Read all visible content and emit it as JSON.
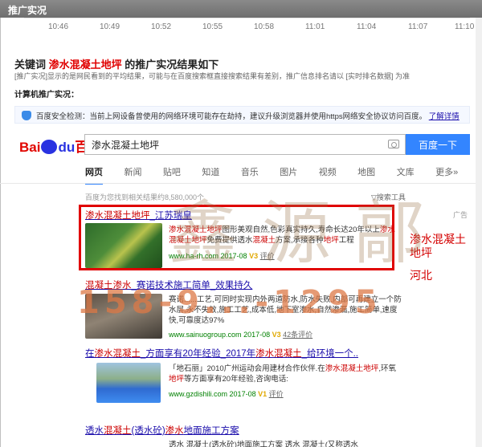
{
  "window": {
    "title": "推广实况"
  },
  "timeline": {
    "ticks": [
      "10:46",
      "10:49",
      "10:52",
      "10:55",
      "10:58",
      "11:01",
      "11:04",
      "11:07",
      "11:10"
    ]
  },
  "heading": {
    "prefix": "关键词",
    "keyword": "渗水混凝土地坪",
    "suffix": "的推广实况结果如下",
    "description": "[推广实况]显示的是网民看到的平均结果，可能与在百度搜索框直接搜索结果有差别，推广信息排名请以 [实时排名数据] 为准",
    "sub_title": "计算机推广实况："
  },
  "notice": {
    "text": "百度安全检测：当前上网设备曾使用的网络环境可能存在劫持，建议升级浏览器并使用https网络安全协议访问百度。",
    "link": "了解详情"
  },
  "baidu": {
    "logo_bai": "Bai",
    "logo_du": "du",
    "logo_zh": "百度",
    "query": "渗水混凝土地坪",
    "search_button": "百度一下",
    "tabs": [
      "网页",
      "新闻",
      "贴吧",
      "知道",
      "音乐",
      "图片",
      "视频",
      "地图",
      "文库",
      "更多»"
    ],
    "result_count": "百度为您找到相关结果约8,580,000个",
    "search_tools": "▽搜索工具",
    "ad_label": "广告"
  },
  "results": [
    {
      "title_hl": "渗水混凝土地坪",
      "title_rest": "_江苏瑞皇",
      "body_1": "渗水混凝土地坪",
      "body_2": "图形美观自然,色彩真实持久,寿命长达20年以上",
      "body_3": "渗水混凝土地坪",
      "body_4": "免费提供透水",
      "body_5": "混凝土",
      "body_6": "方案,承接各种",
      "body_7": "地坪",
      "body_8": "工程",
      "url": "www.ha-rh.com",
      "date": "2017-08",
      "v": "V3",
      "eval": "评价"
    },
    {
      "title_hl": "混凝土渗水",
      "title_rest": "_赛诺技术施工简单_效果持久",
      "body": "赛诺......工艺,可同时实现内外两道防水,防水失败,内部可再建立一个防水层,永不失效,施工工艺,成本低,地下室渗水,自然渗漏,施工简单,速度快,可靠度达97%",
      "url": "www.sainuogroup.com",
      "date": "2017-08",
      "v": "V3",
      "eval": "42条评价"
    },
    {
      "title_a": "在",
      "title_hl1": "渗水混凝土",
      "title_b": "_方面享有20年经验_2017年",
      "title_hl2": "渗水混凝土",
      "title_c": "_给环境一个..",
      "body_a": "「地石丽」2010广州运动会用建材合作伙伴.在",
      "body_hl1": "渗水混凝土",
      "body_b": "地坪",
      "body_c": ",环氧",
      "body_hl2": "地坪",
      "body_d": "等方面享有20年经验,咨询电话:",
      "url": "www.gzdishili.com",
      "date": "2017-08",
      "v": "V1",
      "eval": "评价"
    },
    {
      "title_a": "透水",
      "title_hl1": "混凝土",
      "title_b": "(透水砼)",
      "title_hl2": "渗水",
      "title_c": "地面施工方案",
      "body": "透水 混凝土(透水砼)地面施工方案 透水 混凝土(又称透水"
    }
  ],
  "side_labels": {
    "line1": "渗水混凝土",
    "line2": "地坪",
    "line3": "河北"
  },
  "overlay": {
    "watermark": "鑫源鄗",
    "phone": "158-9...-1295"
  },
  "colors": {
    "baidu_blue": "#3385ff",
    "highlight_red": "#c00000",
    "link_blue": "#1a0dab",
    "url_green": "#008000"
  }
}
